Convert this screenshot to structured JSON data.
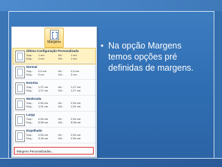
{
  "ribbon": {
    "label": "Margens"
  },
  "menu": {
    "items": [
      {
        "name": "Última Configuração Personalizada",
        "rows": [
          [
            "Sup.:",
            "1 cm",
            "Inf.:",
            "1 cm"
          ],
          [
            "Esq.:",
            "1 cm",
            "Dir.:",
            "1 cm"
          ]
        ]
      },
      {
        "name": "Normal",
        "rows": [
          [
            "Sup.:",
            "2,5 cm",
            "Inf.:",
            "2,5 cm"
          ],
          [
            "Esq.:",
            "3 cm",
            "Dir.:",
            "3 cm"
          ]
        ]
      },
      {
        "name": "Estreita",
        "rows": [
          [
            "Sup.:",
            "1,27 cm",
            "Inf.:",
            "1,27 cm"
          ],
          [
            "Esq.:",
            "1,27 cm",
            "Dir.:",
            "1,27 cm"
          ]
        ]
      },
      {
        "name": "Moderada",
        "rows": [
          [
            "Sup.:",
            "2,54 cm",
            "Inf.:",
            "2,54 cm"
          ],
          [
            "Esq.:",
            "1,91 cm",
            "Dir.:",
            "1,91 cm"
          ]
        ]
      },
      {
        "name": "Larga",
        "rows": [
          [
            "Sup.:",
            "2,54 cm",
            "Inf.:",
            "2,54 cm"
          ],
          [
            "Esq.:",
            "5,08 cm",
            "Dir.:",
            "5,08 cm"
          ]
        ]
      },
      {
        "name": "Espelhado",
        "rows": [
          [
            "Sup.:",
            "2,54 cm",
            "Inf.:",
            "2,54 cm"
          ],
          [
            "Esq.:",
            "3,18 cm",
            "Dir.:",
            "2,54 cm"
          ]
        ]
      }
    ],
    "custom_label": "Margens Personalizadas..."
  },
  "slide": {
    "bullet_text": "Na opção Margens temos opções pré definidas de margens."
  }
}
